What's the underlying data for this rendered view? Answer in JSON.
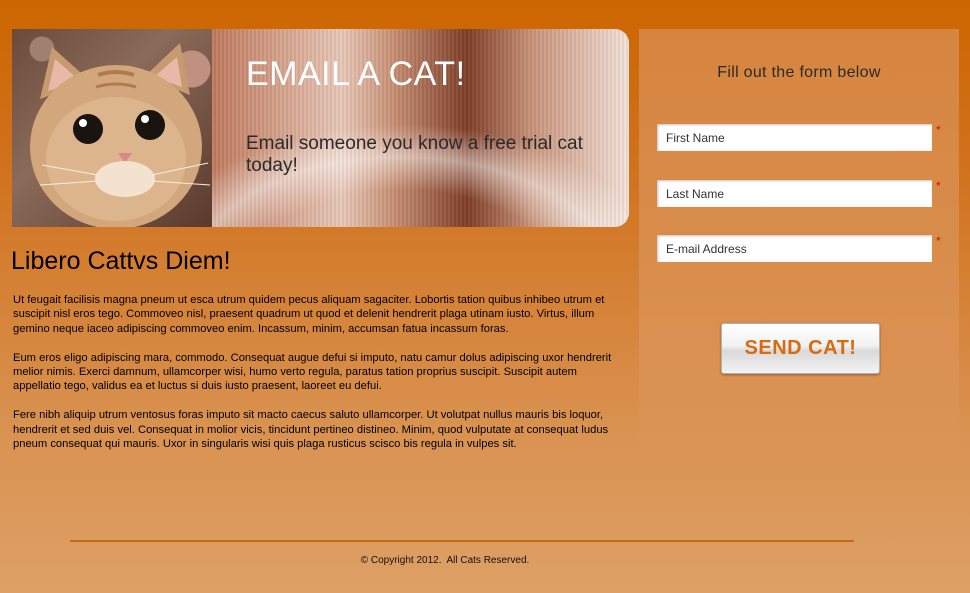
{
  "hero": {
    "title": "EMAIL A CAT!",
    "subtitle": "Email someone you know a free trial cat today!",
    "image_alt": "kitten photo"
  },
  "content": {
    "heading": "Libero Cattvs Diem!",
    "paragraphs": [
      "Ut feugait facilisis magna pneum ut esca utrum quidem pecus aliquam sagaciter. Lobortis tation quibus inhibeo utrum et suscipit nisl eros tego. Commoveo nisl, praesent quadrum ut quod et delenit hendrerit plaga utinam iusto. Virtus, illum gemino neque iaceo adipiscing commoveo enim. Incassum, minim, accumsan fatua incassum foras.",
      "Eum eros eligo adipiscing mara, commodo. Consequat augue defui si imputo, natu camur dolus adipiscing uxor hendrerit melior nimis. Exerci damnum, ullamcorper wisi, humo verto regula, paratus tation proprius suscipit. Suscipit autem appellatio tego, validus ea et luctus si duis iusto praesent, laoreet eu defui.",
      "Fere nibh aliquip utrum ventosus foras imputo sit macto caecus saluto ullamcorper. Ut volutpat nullus mauris bis loquor, hendrerit et sed duis vel. Consequat in molior vicis, tincidunt pertineo distineo. Minim, quod vulputate at consequat ludus pneum consequat qui mauris. Uxor in singularis wisi quis plaga rusticus scisco bis regula in vulpes sit."
    ]
  },
  "form": {
    "title": "Fill out the form below",
    "first_name_placeholder": "First Name",
    "last_name_placeholder": "Last Name",
    "email_placeholder": "E-mail Address",
    "required_marker": "*",
    "submit_label": "SEND CAT!"
  },
  "footer": {
    "copyright": "© Copyright 2012.  All Cats Reserved."
  },
  "colors": {
    "accent_orange": "#cc6600",
    "button_text": "#d96a10",
    "required": "#d01010"
  }
}
